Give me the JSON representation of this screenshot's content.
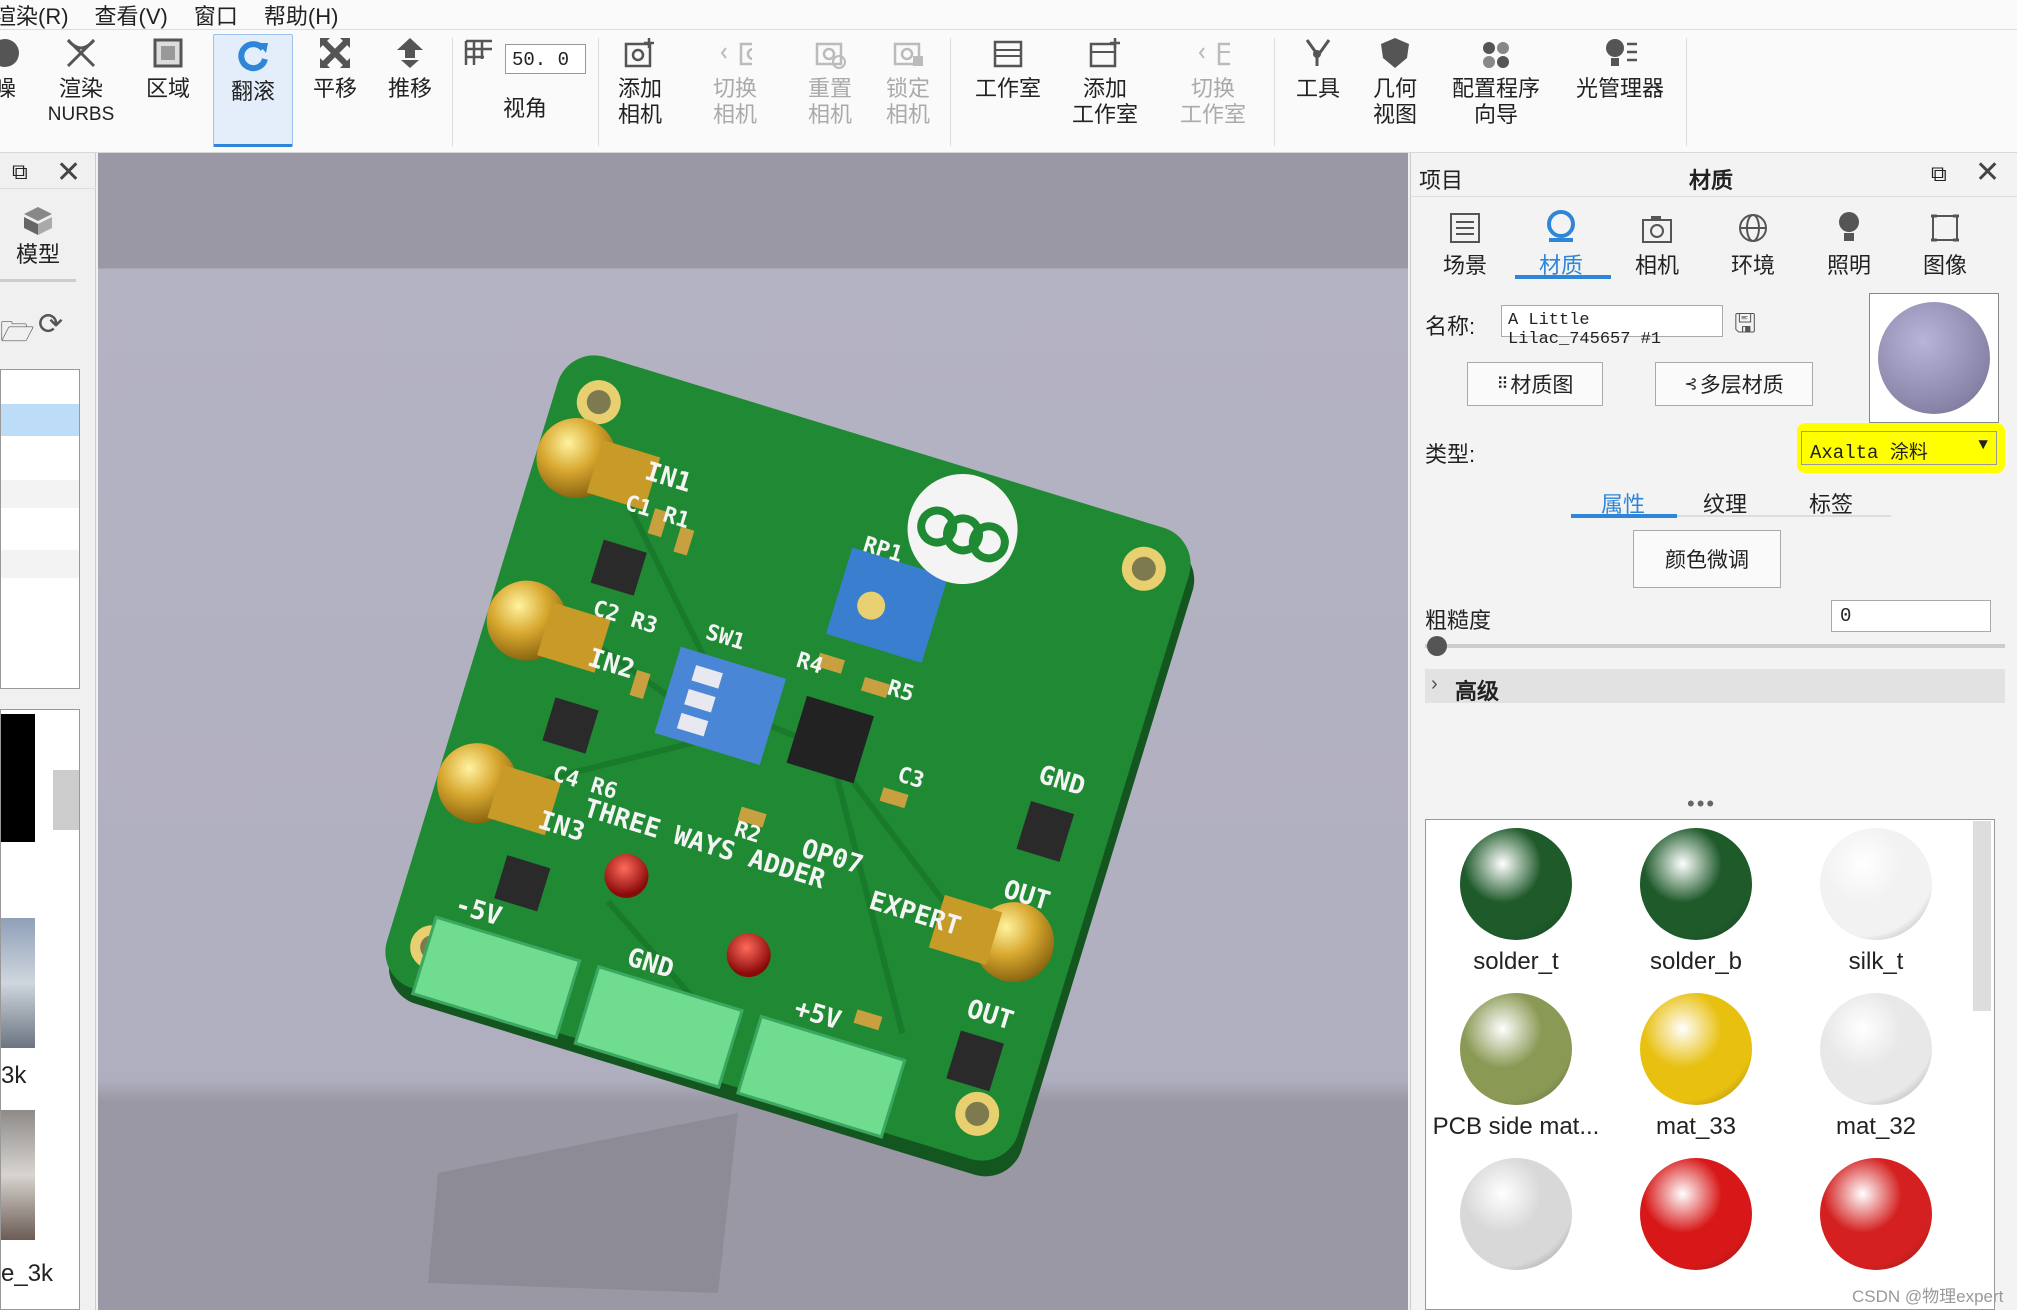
{
  "menu": [
    "渲染(R)",
    "查看(V)",
    "窗口",
    "帮助(H)"
  ],
  "toolbar": {
    "noise": "噪",
    "render_nurbs": [
      "渲染",
      "NURBS"
    ],
    "region": "区域",
    "tumble": "翻滚",
    "pan": "平移",
    "dolly": "推移",
    "fov_value": "50. 0",
    "fov_label": "视角",
    "add_camera": [
      "添加",
      "相机"
    ],
    "switch_camera": [
      "切换",
      "相机"
    ],
    "reset_camera": [
      "重置",
      "相机"
    ],
    "lock_camera": [
      "锁定",
      "相机"
    ],
    "studio": "工作室",
    "add_studio": [
      "添加",
      "工作室"
    ],
    "switch_studio": [
      "切换",
      "工作室"
    ],
    "tools": "工具",
    "geometry_view": [
      "几何",
      "视图"
    ],
    "config_wizard": [
      "配置程序",
      "向导"
    ],
    "light_manager": "光管理器"
  },
  "left_panel": {
    "model_label": "模型",
    "thumb1_label": "3k",
    "thumb2_label": "e_3k"
  },
  "right_panel": {
    "project_label": "项目",
    "title": "材质",
    "tabs": [
      "场景",
      "材质",
      "相机",
      "环境",
      "照明",
      "图像"
    ],
    "active_tab": "材质",
    "name_label": "名称:",
    "name_value": "A Little Lilac_745657 #1",
    "material_graph_btn": "材质图",
    "multilayer_btn": "多层材质",
    "type_label": "类型:",
    "type_value": "Axalta 涂料",
    "subtabs": [
      "属性",
      "纹理",
      "标签"
    ],
    "active_subtab": "属性",
    "color_adjust_btn": "颜色微调",
    "roughness_label": "粗糙度",
    "roughness_value": "0",
    "advanced_label": "高级",
    "more_dots": "•••",
    "materials": [
      {
        "name": "solder_t",
        "color": "#1e5a2a"
      },
      {
        "name": "solder_b",
        "color": "#1e5a2a"
      },
      {
        "name": "silk_t",
        "color": "#f2f2f2"
      },
      {
        "name": "PCB side mat...",
        "color": "#8a9a55"
      },
      {
        "name": "mat_33",
        "color": "#e8c010"
      },
      {
        "name": "mat_32",
        "color": "#e8e8e8"
      },
      {
        "name": "",
        "color": "#d8d8d8"
      },
      {
        "name": "",
        "color": "#d81818"
      },
      {
        "name": "",
        "color": "#d42020"
      }
    ]
  },
  "watermark": "CSDN @物理expert",
  "colors": {
    "highlight": "#ffff00",
    "accent": "#2f86d8",
    "pcb": "#1f8a33"
  }
}
